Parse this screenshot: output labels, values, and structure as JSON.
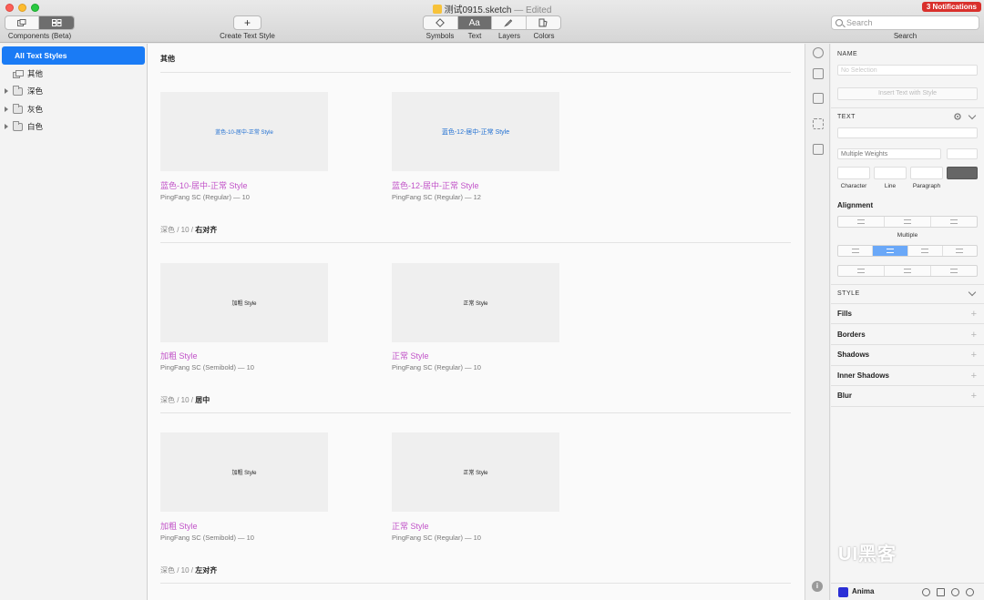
{
  "window": {
    "filename": "测试0915.sketch",
    "edited": "— Edited",
    "notifications": "3 Notifications"
  },
  "toolbar": {
    "components_label": "Components (Beta)",
    "create_text_style_label": "Create Text Style",
    "create_text_style_glyph": "+",
    "text_glyph": "Aa",
    "tabs": [
      "Symbols",
      "Text",
      "Layers",
      "Colors"
    ],
    "search_label": "Search",
    "search_placeholder": "Search"
  },
  "sidebar": {
    "items": [
      {
        "label": "All Text Styles",
        "active": true
      },
      {
        "label": "其他"
      },
      {
        "label": "深色"
      },
      {
        "label": "灰色"
      },
      {
        "label": "白色"
      }
    ]
  },
  "canvas": {
    "section_title": "其他",
    "groups": [
      {
        "cards": [
          {
            "preview": "蓝色-10-居中-正常 Style",
            "name": "蓝色-10-居中-正常 Style",
            "meta": "PingFang SC (Regular) — 10"
          },
          {
            "preview": "蓝色-12-居中-正常 Style",
            "name": "蓝色-12-居中-正常 Style",
            "meta": "PingFang SC (Regular) — 12"
          }
        ],
        "path": "深色 / 10 /",
        "path_bold": "右对齐"
      },
      {
        "cards": [
          {
            "preview": "加粗 Style",
            "name": "加粗 Style",
            "meta": "PingFang SC (Semibold) — 10"
          },
          {
            "preview": "正常 Style",
            "name": "正常 Style",
            "meta": "PingFang SC (Regular) — 10"
          }
        ],
        "path": "深色 / 10 /",
        "path_bold": "居中"
      },
      {
        "cards": [
          {
            "preview": "加粗 Style",
            "name": "加粗 Style",
            "meta": "PingFang SC (Semibold) — 10"
          },
          {
            "preview": "正常 Style",
            "name": "正常 Style",
            "meta": "PingFang SC (Regular) — 10"
          }
        ],
        "path": "深色 / 10 /",
        "path_bold": "左对齐"
      }
    ]
  },
  "inspector": {
    "name_header": "NAME",
    "name_placeholder": "No Selection",
    "insert_text_button": "Insert Text with Style",
    "text_header": "TEXT",
    "weight_value": "Multiple Weights",
    "character_label": "Character",
    "line_label": "Line",
    "paragraph_label": "Paragraph",
    "alignment_header": "Alignment",
    "multiple_label": "Multiple",
    "style_header": "STYLE",
    "sections": [
      "Fills",
      "Borders",
      "Shadows",
      "Inner Shadows",
      "Blur"
    ],
    "anima_label": "Anima"
  },
  "watermark": "UI黑客",
  "colors": {
    "accent": "#1a7bf5",
    "style_name": "#c152c8",
    "preview_blue": "#1f6fd2",
    "notification": "#d9302c",
    "align_selected": "#6aa8f8"
  }
}
